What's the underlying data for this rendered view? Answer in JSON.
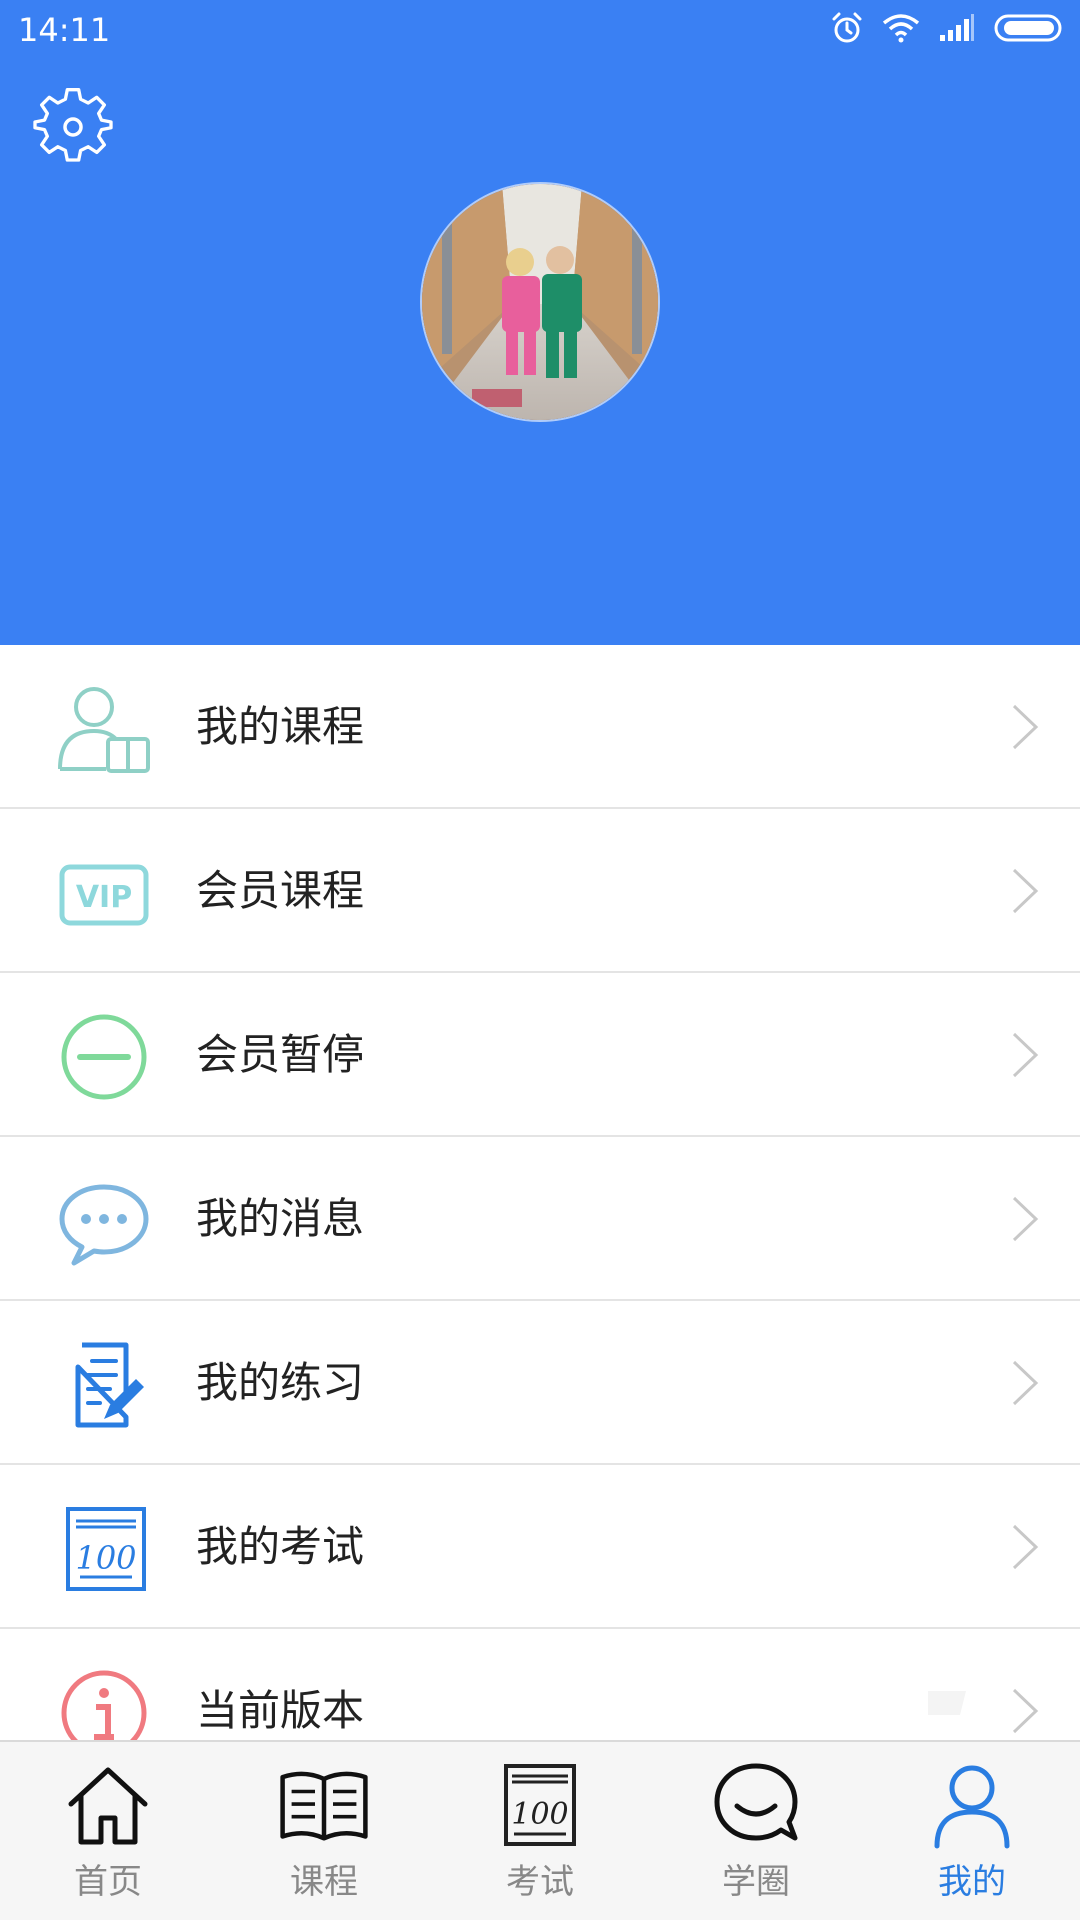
{
  "status_bar": {
    "time": "14:11",
    "icons": [
      "alarm-icon",
      "wifi-icon",
      "signal-icon",
      "battery-icon"
    ]
  },
  "header": {
    "settings_icon": "gear-icon",
    "avatar_description": "profile-avatar"
  },
  "menu": {
    "items": [
      {
        "label": "我的课程",
        "icon": "user-book-icon"
      },
      {
        "label": "会员课程",
        "icon": "vip-icon"
      },
      {
        "label": "会员暂停",
        "icon": "minus-circle-icon"
      },
      {
        "label": "我的消息",
        "icon": "chat-bubble-icon"
      },
      {
        "label": "我的练习",
        "icon": "document-edit-icon"
      },
      {
        "label": "我的考试",
        "icon": "score-100-icon"
      },
      {
        "label": "当前版本",
        "icon": "info-icon"
      }
    ]
  },
  "tabbar": {
    "tabs": [
      {
        "label": "首页",
        "icon": "home-icon",
        "active": false
      },
      {
        "label": "课程",
        "icon": "book-icon",
        "active": false
      },
      {
        "label": "考试",
        "icon": "score-100-icon",
        "active": false
      },
      {
        "label": "学圈",
        "icon": "chat-icon",
        "active": false
      },
      {
        "label": "我的",
        "icon": "person-icon",
        "active": true
      }
    ]
  },
  "colors": {
    "header_bg": "#3a80f3",
    "active_tab": "#2a7de1",
    "inactive_tab": "#888888"
  }
}
